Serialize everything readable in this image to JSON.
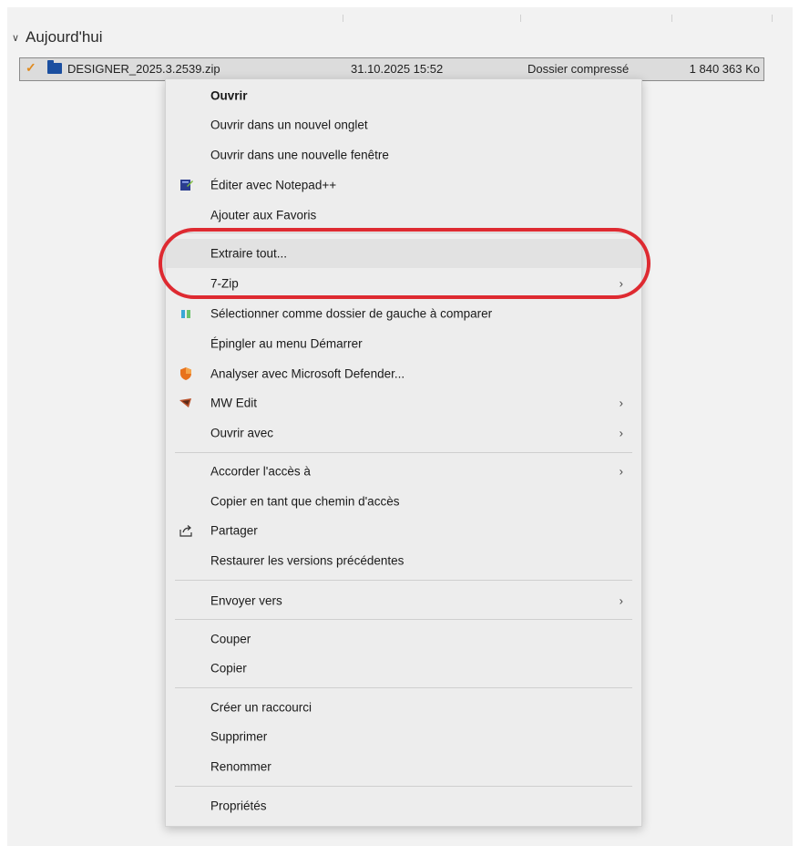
{
  "group": {
    "label": "Aujourd'hui",
    "chevron_icon": "chevron-down-icon"
  },
  "file": {
    "name": "DESIGNER_2025.3.2539.zip",
    "date": "31.10.2025 15:52",
    "type": "Dossier compressé",
    "size": "1 840 363 Ko",
    "check_icon": "checkmark-icon",
    "folder_icon": "zip-folder-icon"
  },
  "menu": {
    "items": [
      {
        "label": "Ouvrir",
        "bold": true
      },
      {
        "label": "Ouvrir dans un nouvel onglet"
      },
      {
        "label": "Ouvrir dans une nouvelle fenêtre"
      },
      {
        "label": "Éditer avec Notepad++",
        "icon": "notepad-plus-plus-icon"
      },
      {
        "label": "Ajouter aux Favoris"
      },
      {
        "label": "Extraire tout...",
        "hovered": true
      },
      {
        "label": "7-Zip",
        "submenu": true
      },
      {
        "label": "Sélectionner comme dossier de gauche à comparer",
        "icon": "compare-icon"
      },
      {
        "label": "Épingler au menu Démarrer"
      },
      {
        "label": "Analyser avec Microsoft Defender...",
        "icon": "defender-shield-icon"
      },
      {
        "label": "MW Edit",
        "icon": "mw-edit-icon",
        "submenu": true
      },
      {
        "label": "Ouvrir avec",
        "submenu": true
      },
      {
        "label": "Accorder l'accès à",
        "submenu": true
      },
      {
        "label": "Copier en tant que chemin d'accès"
      },
      {
        "label": "Partager",
        "icon": "share-icon"
      },
      {
        "label": "Restaurer les versions précédentes"
      },
      {
        "label": "Envoyer vers",
        "submenu": true
      },
      {
        "label": "Couper"
      },
      {
        "label": "Copier"
      },
      {
        "label": "Créer un raccourci"
      },
      {
        "label": "Supprimer"
      },
      {
        "label": "Renommer"
      },
      {
        "label": "Propriétés"
      }
    ],
    "submenu_arrow": "›"
  },
  "colors": {
    "highlight_ring": "#de2a31",
    "menu_background": "#ededed",
    "hover_background": "#e2e2e2",
    "selected_row": "#dcdcdc"
  }
}
